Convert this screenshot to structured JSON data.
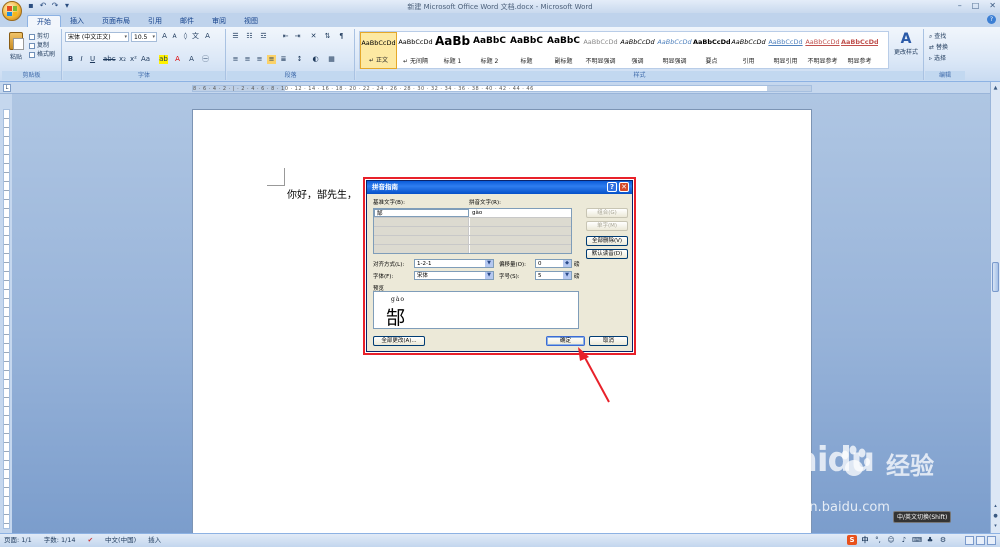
{
  "window": {
    "title": "新建 Microsoft Office Word 文档.docx - Microsoft Word"
  },
  "tabs": [
    "开始",
    "插入",
    "页面布局",
    "引用",
    "邮件",
    "审阅",
    "视图"
  ],
  "ribbon": {
    "clipboard": {
      "paste": "粘贴",
      "cut": "剪切",
      "copy": "复制",
      "format_painter": "格式刷",
      "group_label": "剪贴板"
    },
    "font": {
      "font_name": "宋体 (中文正文)",
      "font_size": "10.5",
      "group_label": "字体"
    },
    "paragraph": {
      "group_label": "段落"
    },
    "styles": {
      "group_label": "样式",
      "items": [
        {
          "sample": "AaBbCcDd",
          "name": "↵ 正文"
        },
        {
          "sample": "AaBbCcDd",
          "name": "↵ 无间隔"
        },
        {
          "sample": "AaBb",
          "name": "标题 1"
        },
        {
          "sample": "AaBbC",
          "name": "标题 2"
        },
        {
          "sample": "AaBbC",
          "name": "标题"
        },
        {
          "sample": "AaBbC",
          "name": "副标题"
        },
        {
          "sample": "AaBbCcDd",
          "name": "不明显强调"
        },
        {
          "sample": "AaBbCcDd",
          "name": "强调"
        },
        {
          "sample": "AaBbCcDd",
          "name": "明显强调"
        },
        {
          "sample": "AaBbCcDd",
          "name": "要点"
        },
        {
          "sample": "AaBbCcDd",
          "name": "引用"
        },
        {
          "sample": "AaBbCcDd",
          "name": "明显引用"
        },
        {
          "sample": "AaBbCcDd",
          "name": "不明显参考"
        },
        {
          "sample": "AaBbCcDd",
          "name": "明显参考"
        }
      ],
      "change_styles": "更改样式"
    },
    "editing": {
      "group_label": "编辑",
      "find": "查找",
      "replace": "替换",
      "select": "选择"
    }
  },
  "ruler": {
    "ticks": "8 · 6 · 4 · 2 · | · 2 · 4 · 6 · 8 · 10 · 12 · 14 · 16 · 18 · 20 · 22 · 24 · 26 · 28 · 30 · 32 · 34 · 36 · 38 · 40 · 42 · 44 · 46"
  },
  "document": {
    "text": "你好，郜先生，"
  },
  "dialog": {
    "title": "拼音指南",
    "base_text_label": "基准文字(B):",
    "ruby_text_label": "拼音文字(R):",
    "rows": [
      {
        "base": "郜",
        "ruby": "gào"
      },
      {
        "base": "",
        "ruby": ""
      },
      {
        "base": "",
        "ruby": ""
      },
      {
        "base": "",
        "ruby": ""
      },
      {
        "base": "",
        "ruby": ""
      }
    ],
    "buttons": {
      "group": "组合(G)",
      "mono": "单字(M)",
      "clear_all": "全部删除(V)",
      "default_reading": "默认读音(D)",
      "apply_all": "全部更改(A)...",
      "ok": "确定",
      "cancel": "取消"
    },
    "alignment_label": "对齐方式(L):",
    "alignment_value": "1-2-1",
    "offset_label": "偏移量(O):",
    "offset_value": "0",
    "offset_unit": "磅",
    "font_label": "字体(F):",
    "font_value": "宋体",
    "size_label": "字号(S):",
    "size_value": "5",
    "size_unit": "磅",
    "preview_label": "预览",
    "preview_ruby": "gào",
    "preview_base": "郜"
  },
  "statusbar": {
    "page": "页面: 1/1",
    "words": "字数: 1/14",
    "language": "中文(中国)",
    "mode": "插入"
  },
  "ime": {
    "logo": "S",
    "mode": "中",
    "tooltip": "中/英文切换(Shift)"
  },
  "watermark": {
    "brand": "Baidu",
    "cn": "经验",
    "url": "jingyan.baidu.com"
  },
  "colors": {
    "accent_red": "#e8212a",
    "title_blue": "#0a5bd8",
    "ribbon_bg": "#dce8f7",
    "workspace_bg": "#97b3d9"
  }
}
